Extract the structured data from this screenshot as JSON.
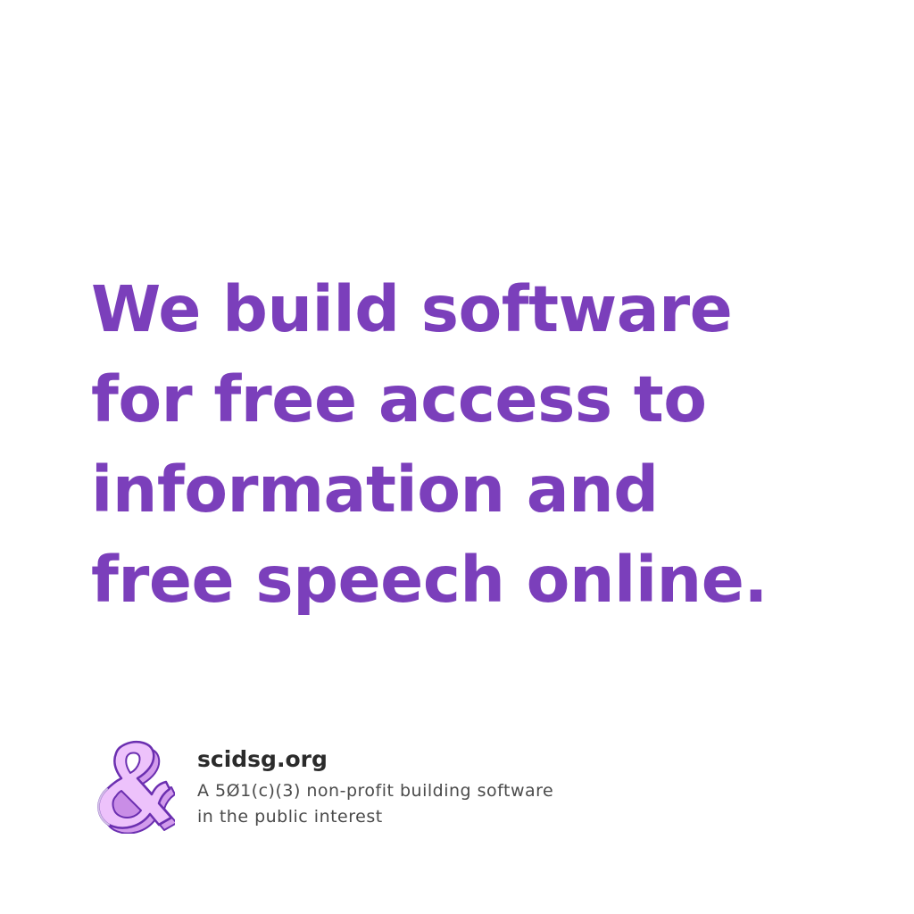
{
  "headline": {
    "lines": [
      "We build software",
      "for free access to",
      "information and",
      "free speech online."
    ]
  },
  "footer": {
    "site": "scidsg.org",
    "tagline_lines": [
      "A 5Ø1(c)(3) non-profit building software",
      "in the public interest"
    ],
    "logo_icon": "ampersand-logo"
  },
  "colors": {
    "headline": "#7b3fbb",
    "site_text": "#2b2b2b",
    "tagline_text": "#4a4a4a",
    "logo_fill": "#e8b4f8",
    "logo_stroke": "#6b2fb0",
    "background": "#ffffff"
  }
}
